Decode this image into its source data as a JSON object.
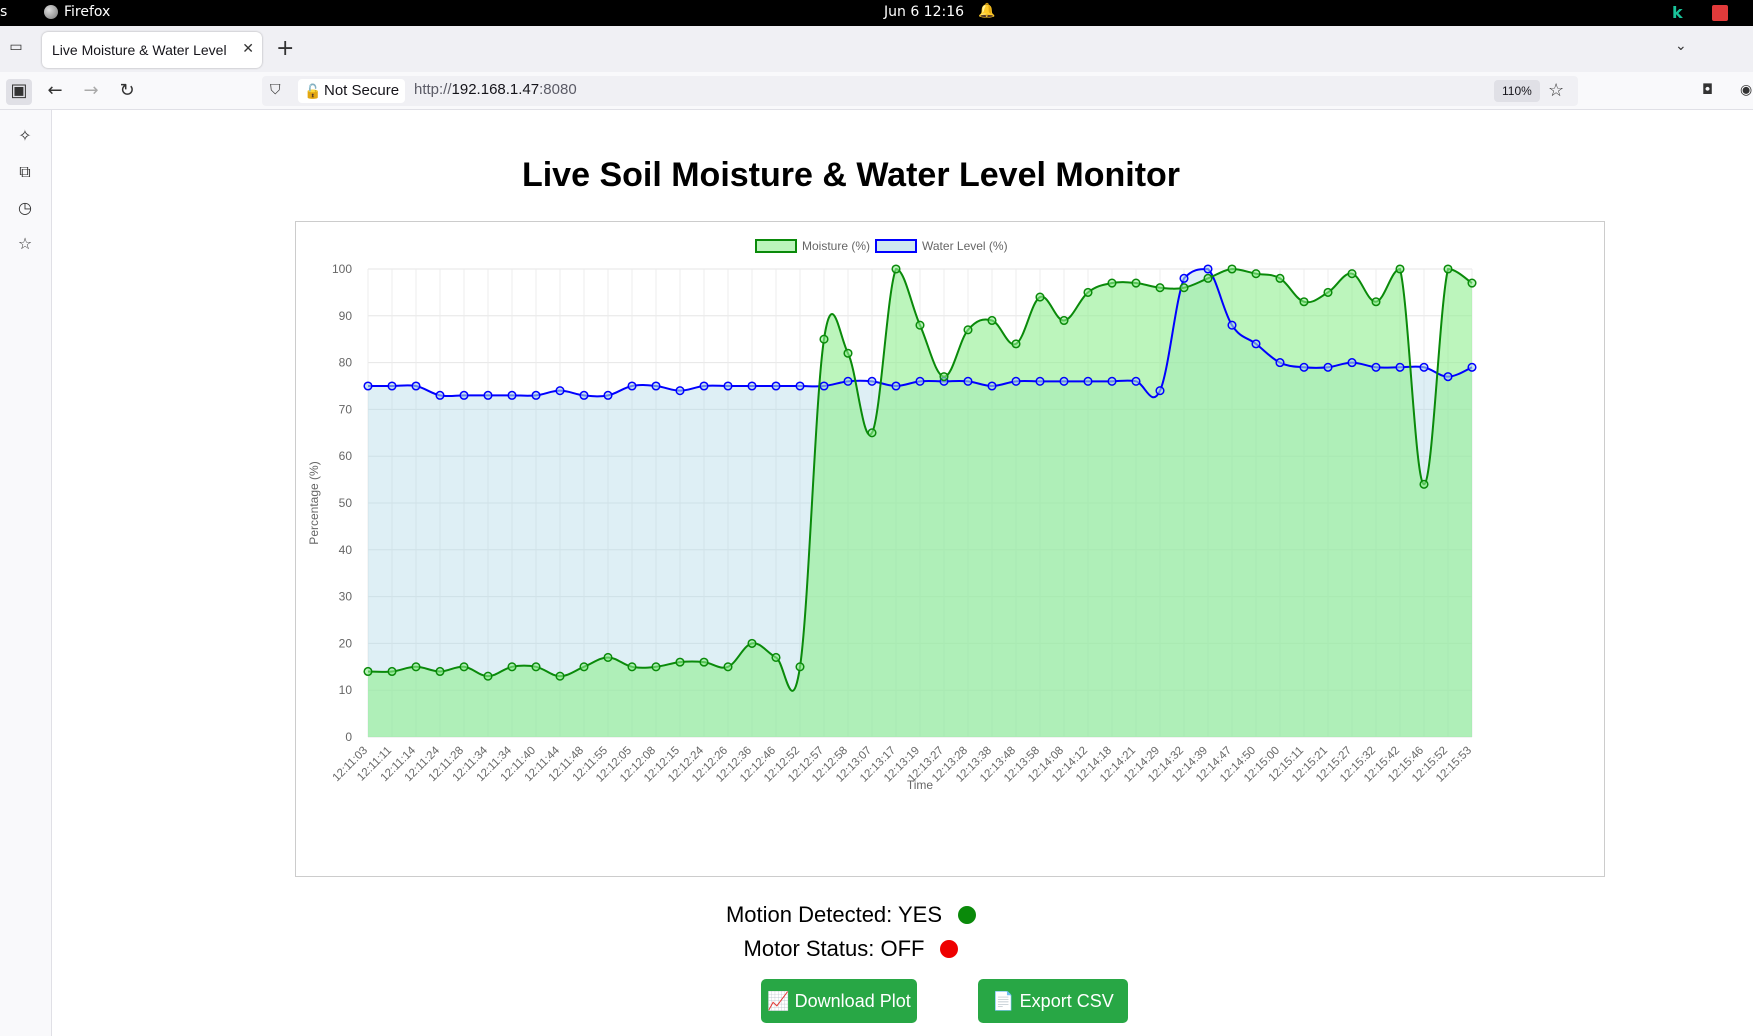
{
  "system_bar": {
    "activities": "s",
    "app_name": "Firefox",
    "clock": "Jun 6  12:16"
  },
  "browser": {
    "tab_title": "Live Moisture & Water Level",
    "security_label": "Not Secure",
    "url_scheme": "http://",
    "url_host": "192.168.1.47",
    "url_port": ":8080",
    "zoom": "110%"
  },
  "page": {
    "title": "Live Soil Moisture & Water Level Monitor",
    "motion_label": "Motion Detected: YES",
    "motor_label": "Motor Status: OFF",
    "download_button": "📈 Download Plot",
    "export_button": "📄 Export CSV",
    "colors": {
      "motion_dot": "#0a8a0a",
      "motor_dot": "#ee0000",
      "button": "#28a745"
    }
  },
  "chart_data": {
    "type": "line",
    "xlabel": "Time",
    "ylabel": "Percentage (%)",
    "ylim": [
      0,
      100
    ],
    "yticks": [
      0,
      10,
      20,
      30,
      40,
      50,
      60,
      70,
      80,
      90,
      100
    ],
    "grid": true,
    "legend_position": "top",
    "categories": [
      "12:11:03",
      "12:11:11",
      "12:11:14",
      "12:11:24",
      "12:11:28",
      "12:11:34",
      "12:11:34",
      "12:11:40",
      "12:11:44",
      "12:11:48",
      "12:11:55",
      "12:12:05",
      "12:12:08",
      "12:12:15",
      "12:12:24",
      "12:12:26",
      "12:12:36",
      "12:12:46",
      "12:12:52",
      "12:12:57",
      "12:12:58",
      "12:13:07",
      "12:13:17",
      "12:13:19",
      "12:13:27",
      "12:13:28",
      "12:13:38",
      "12:13:48",
      "12:13:58",
      "12:14:08",
      "12:14:12",
      "12:14:18",
      "12:14:21",
      "12:14:29",
      "12:14:32",
      "12:14:39",
      "12:14:47",
      "12:14:50",
      "12:15:00",
      "12:15:11",
      "12:15:21",
      "12:15:27",
      "12:15:32",
      "12:15:42",
      "12:15:46",
      "12:15:52",
      "12:15:53"
    ],
    "series": [
      {
        "name": "Moisture (%)",
        "color": "#0a8a0a",
        "fill": "#90ee90",
        "values": [
          14,
          14,
          15,
          14,
          15,
          13,
          15,
          15,
          13,
          15,
          17,
          15,
          15,
          16,
          16,
          15,
          20,
          17,
          15,
          85,
          82,
          65,
          100,
          88,
          77,
          87,
          89,
          84,
          94,
          89,
          95,
          97,
          97,
          96,
          96,
          98,
          100,
          99,
          98,
          93,
          95,
          99,
          93,
          100,
          54,
          100,
          97
        ]
      },
      {
        "name": "Water Level (%)",
        "color": "#0000ff",
        "fill": "#add8e6",
        "values": [
          75,
          75,
          75,
          73,
          73,
          73,
          73,
          73,
          74,
          73,
          73,
          75,
          75,
          74,
          75,
          75,
          75,
          75,
          75,
          75,
          76,
          76,
          75,
          76,
          76,
          76,
          75,
          76,
          76,
          76,
          76,
          76,
          76,
          74,
          98,
          100,
          88,
          84,
          80,
          79,
          79,
          80,
          79,
          79,
          79,
          77,
          79
        ]
      }
    ]
  }
}
